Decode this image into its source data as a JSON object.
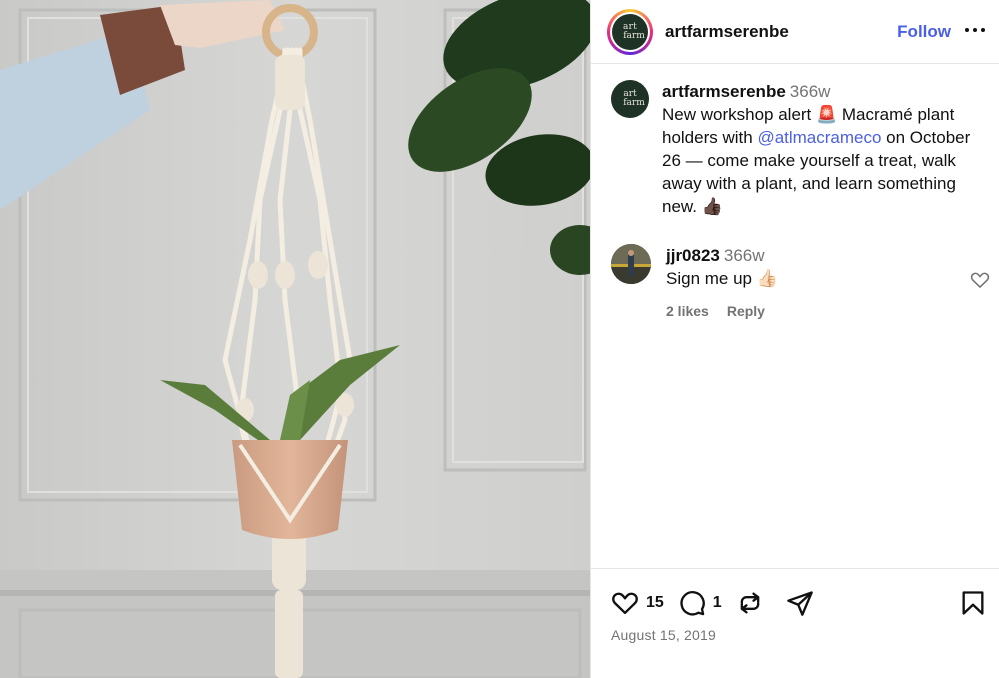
{
  "post": {
    "username": "artfarmserenbe",
    "follow_label": "Follow",
    "avatar_text_1": "art",
    "avatar_text_2": "farm",
    "image": {
      "icon": "macrame-plant-hanger-photo"
    }
  },
  "caption": {
    "username": "artfarmserenbe",
    "time": "366w",
    "text_before": "New workshop alert 🚨 Macramé plant holders with ",
    "mention": "@atlmacrameco",
    "text_after": " on October 26 — come make yourself a treat, walk away with a plant, and learn something new. 👍🏿"
  },
  "comments": [
    {
      "username": "jjr0823",
      "time": "366w",
      "text": "Sign me up 👍🏻",
      "likes": "2 likes",
      "reply_label": "Reply"
    }
  ],
  "actions": {
    "like_count": "15",
    "comment_count": "1",
    "date": "August 15, 2019"
  },
  "colors": {
    "accent": "#4a5fe6",
    "muted": "#737373"
  }
}
